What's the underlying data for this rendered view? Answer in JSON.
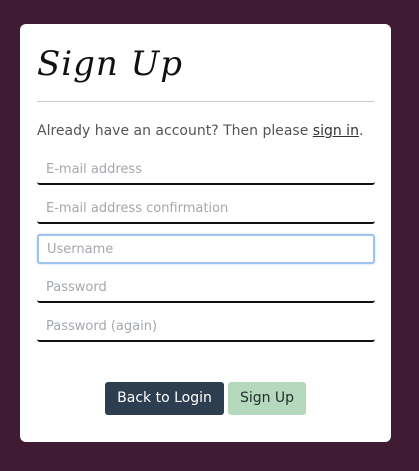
{
  "form": {
    "title": "Sign Up",
    "account_prompt": "Already have an account? Then please ",
    "sign_in_link": "sign in",
    "account_suffix": ".",
    "fields": {
      "email": {
        "placeholder": "E-mail address",
        "value": ""
      },
      "email_confirm": {
        "placeholder": "E-mail address confirmation",
        "value": ""
      },
      "username": {
        "placeholder": "Username",
        "value": ""
      },
      "password": {
        "placeholder": "Password",
        "value": ""
      },
      "password_again": {
        "placeholder": "Password (again)",
        "value": ""
      }
    },
    "focused_field": "username"
  },
  "actions": {
    "back_label": "Back to Login",
    "signup_label": "Sign Up"
  },
  "colors": {
    "page_background": "#3f1b34",
    "card_background": "#ffffff",
    "back_button": "#2c3e50",
    "signup_button": "#b6d9bd",
    "focus_ring": "#9ec3ee"
  }
}
